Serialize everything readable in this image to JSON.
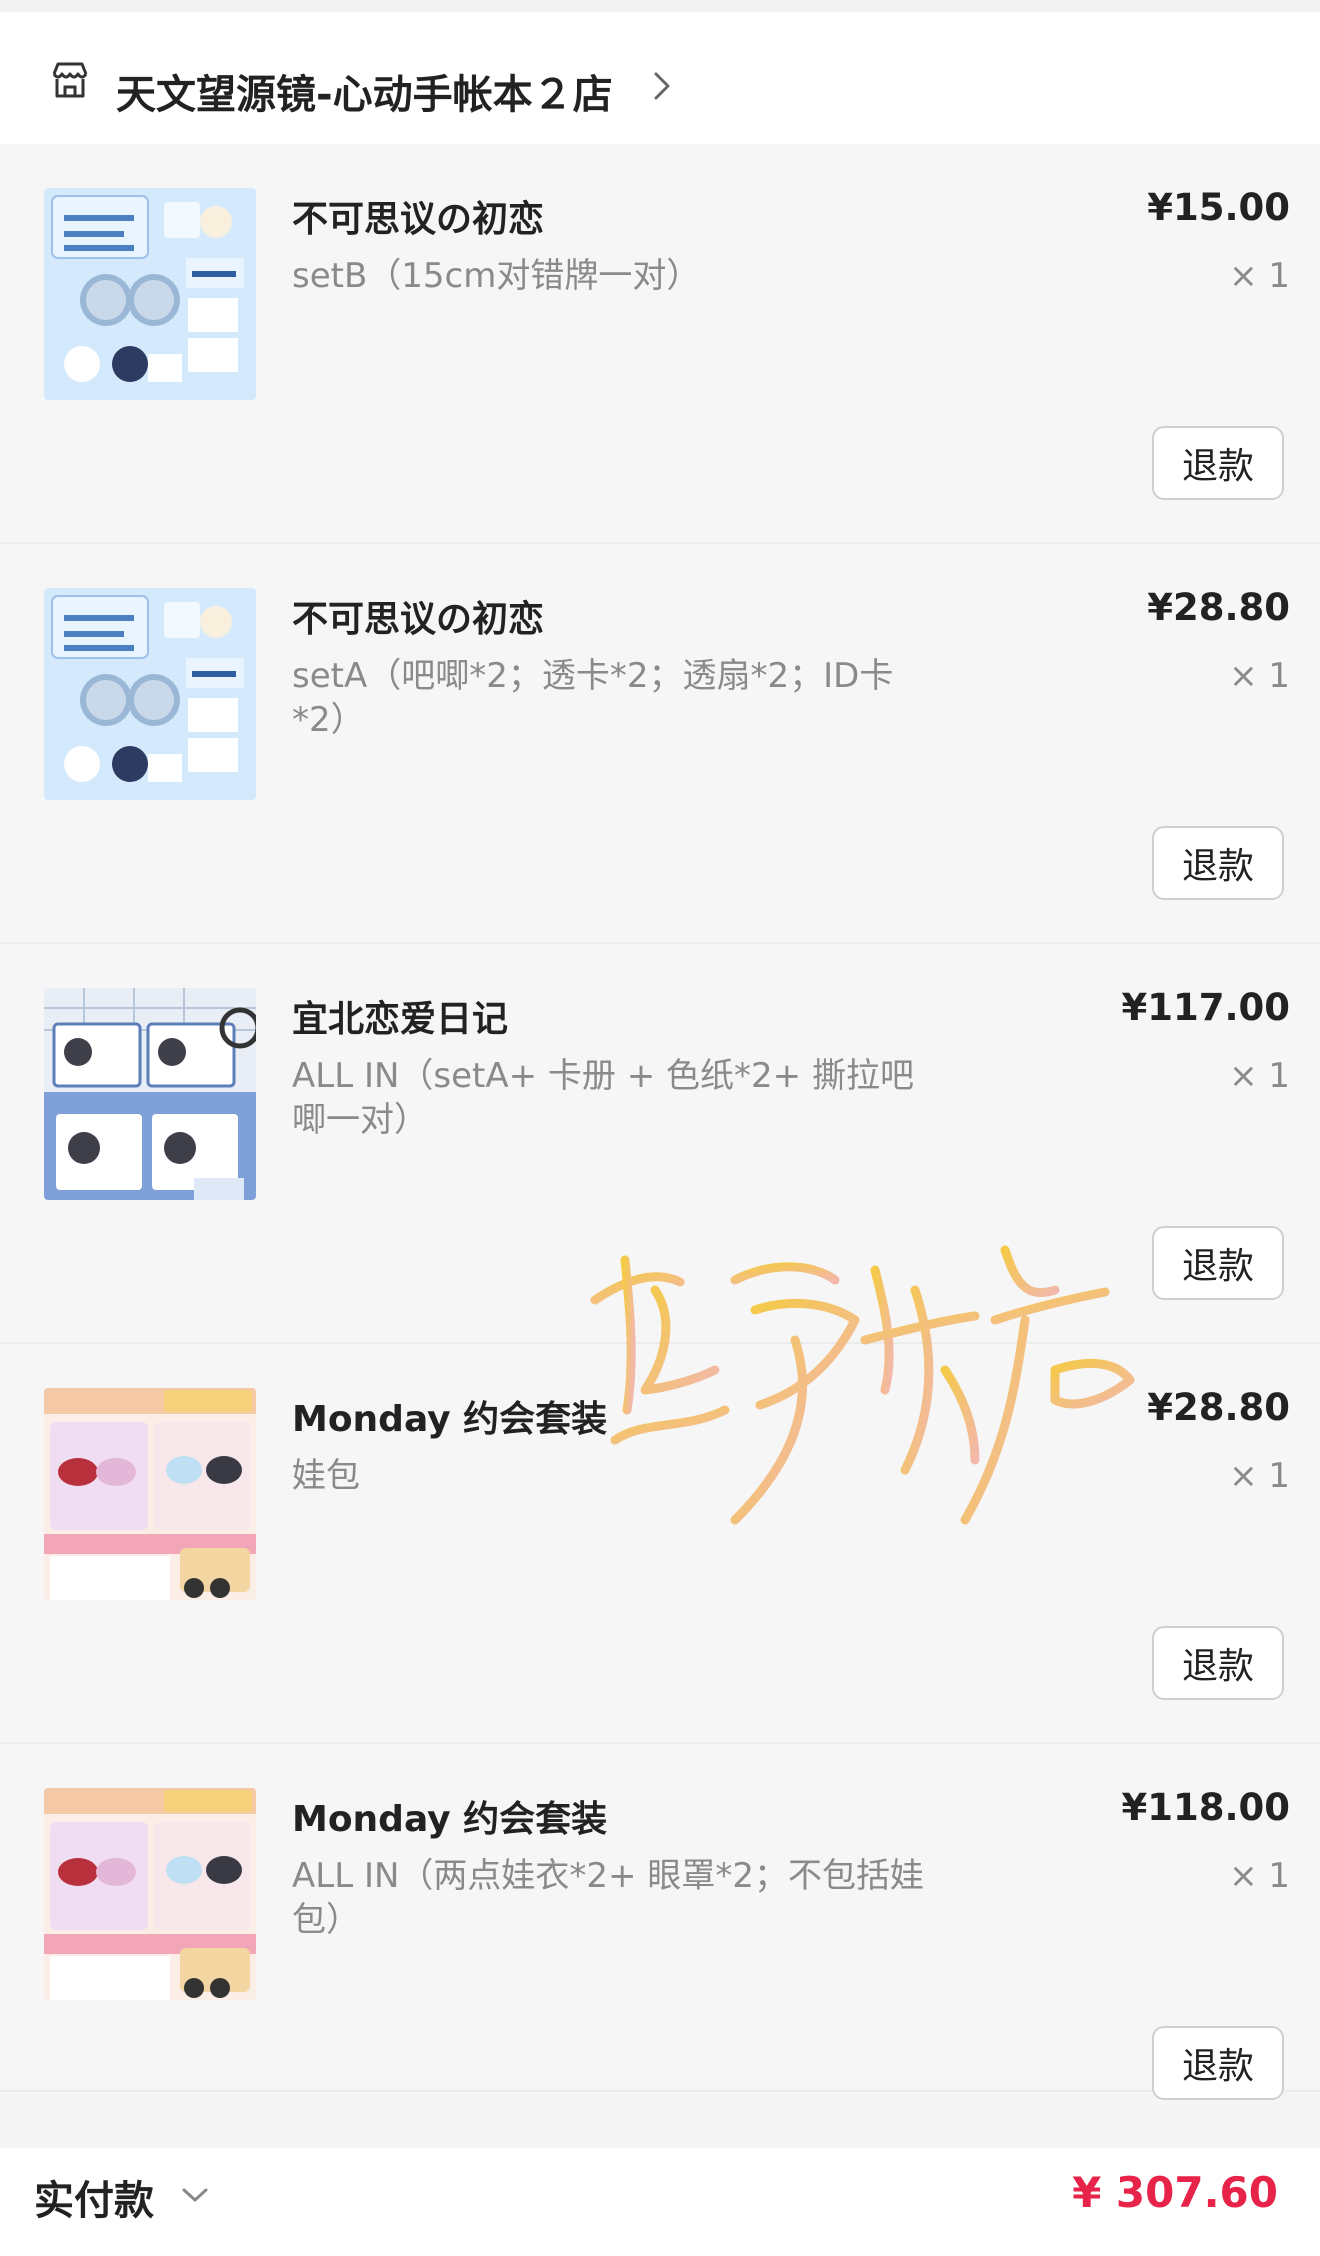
{
  "shop": {
    "name": "天文望源镜-心动手帐本２店"
  },
  "items": [
    {
      "title": "不可思议の初恋",
      "spec": "setB（15cm对错牌一对）",
      "price": "¥15.00",
      "qty": "× 1",
      "refund_label": "退款",
      "thumb_theme": "blue-badge-set"
    },
    {
      "title": "不可思议の初恋",
      "spec": "setA（吧唧*2；透卡*2；透扇*2；ID卡*2）",
      "price": "¥28.80",
      "qty": "× 1",
      "refund_label": "退款",
      "thumb_theme": "blue-badge-set"
    },
    {
      "title": "宜北恋爱日记",
      "spec": "ALL IN（setA+ 卡册 + 色纸*2+ 撕拉吧唧一对）",
      "price": "¥117.00",
      "qty": "× 1",
      "refund_label": "退款",
      "thumb_theme": "blue-card-binder"
    },
    {
      "title": "Monday 约会套装",
      "spec": "娃包",
      "price": "¥28.80",
      "qty": "× 1",
      "refund_label": "退款",
      "thumb_theme": "doll-clothes-sheet"
    },
    {
      "title": "Monday 约会套装",
      "spec": "ALL IN（两点娃衣*2+ 眼罩*2；不包括娃包）",
      "price": "¥118.00",
      "qty": "× 1",
      "refund_label": "退款",
      "thumb_theme": "doll-clothes-sheet"
    }
  ],
  "footer": {
    "label": "实付款",
    "total": "¥ 307.60"
  },
  "icons": {
    "shop": "storefront-icon",
    "shop_chevron": "chevron-right-icon",
    "footer_chevron": "chevron-down-icon"
  },
  "colors": {
    "accent_price": "#e8234a",
    "watermark": "#f0b43a"
  },
  "watermark": {
    "text": "卷雾旅店"
  }
}
